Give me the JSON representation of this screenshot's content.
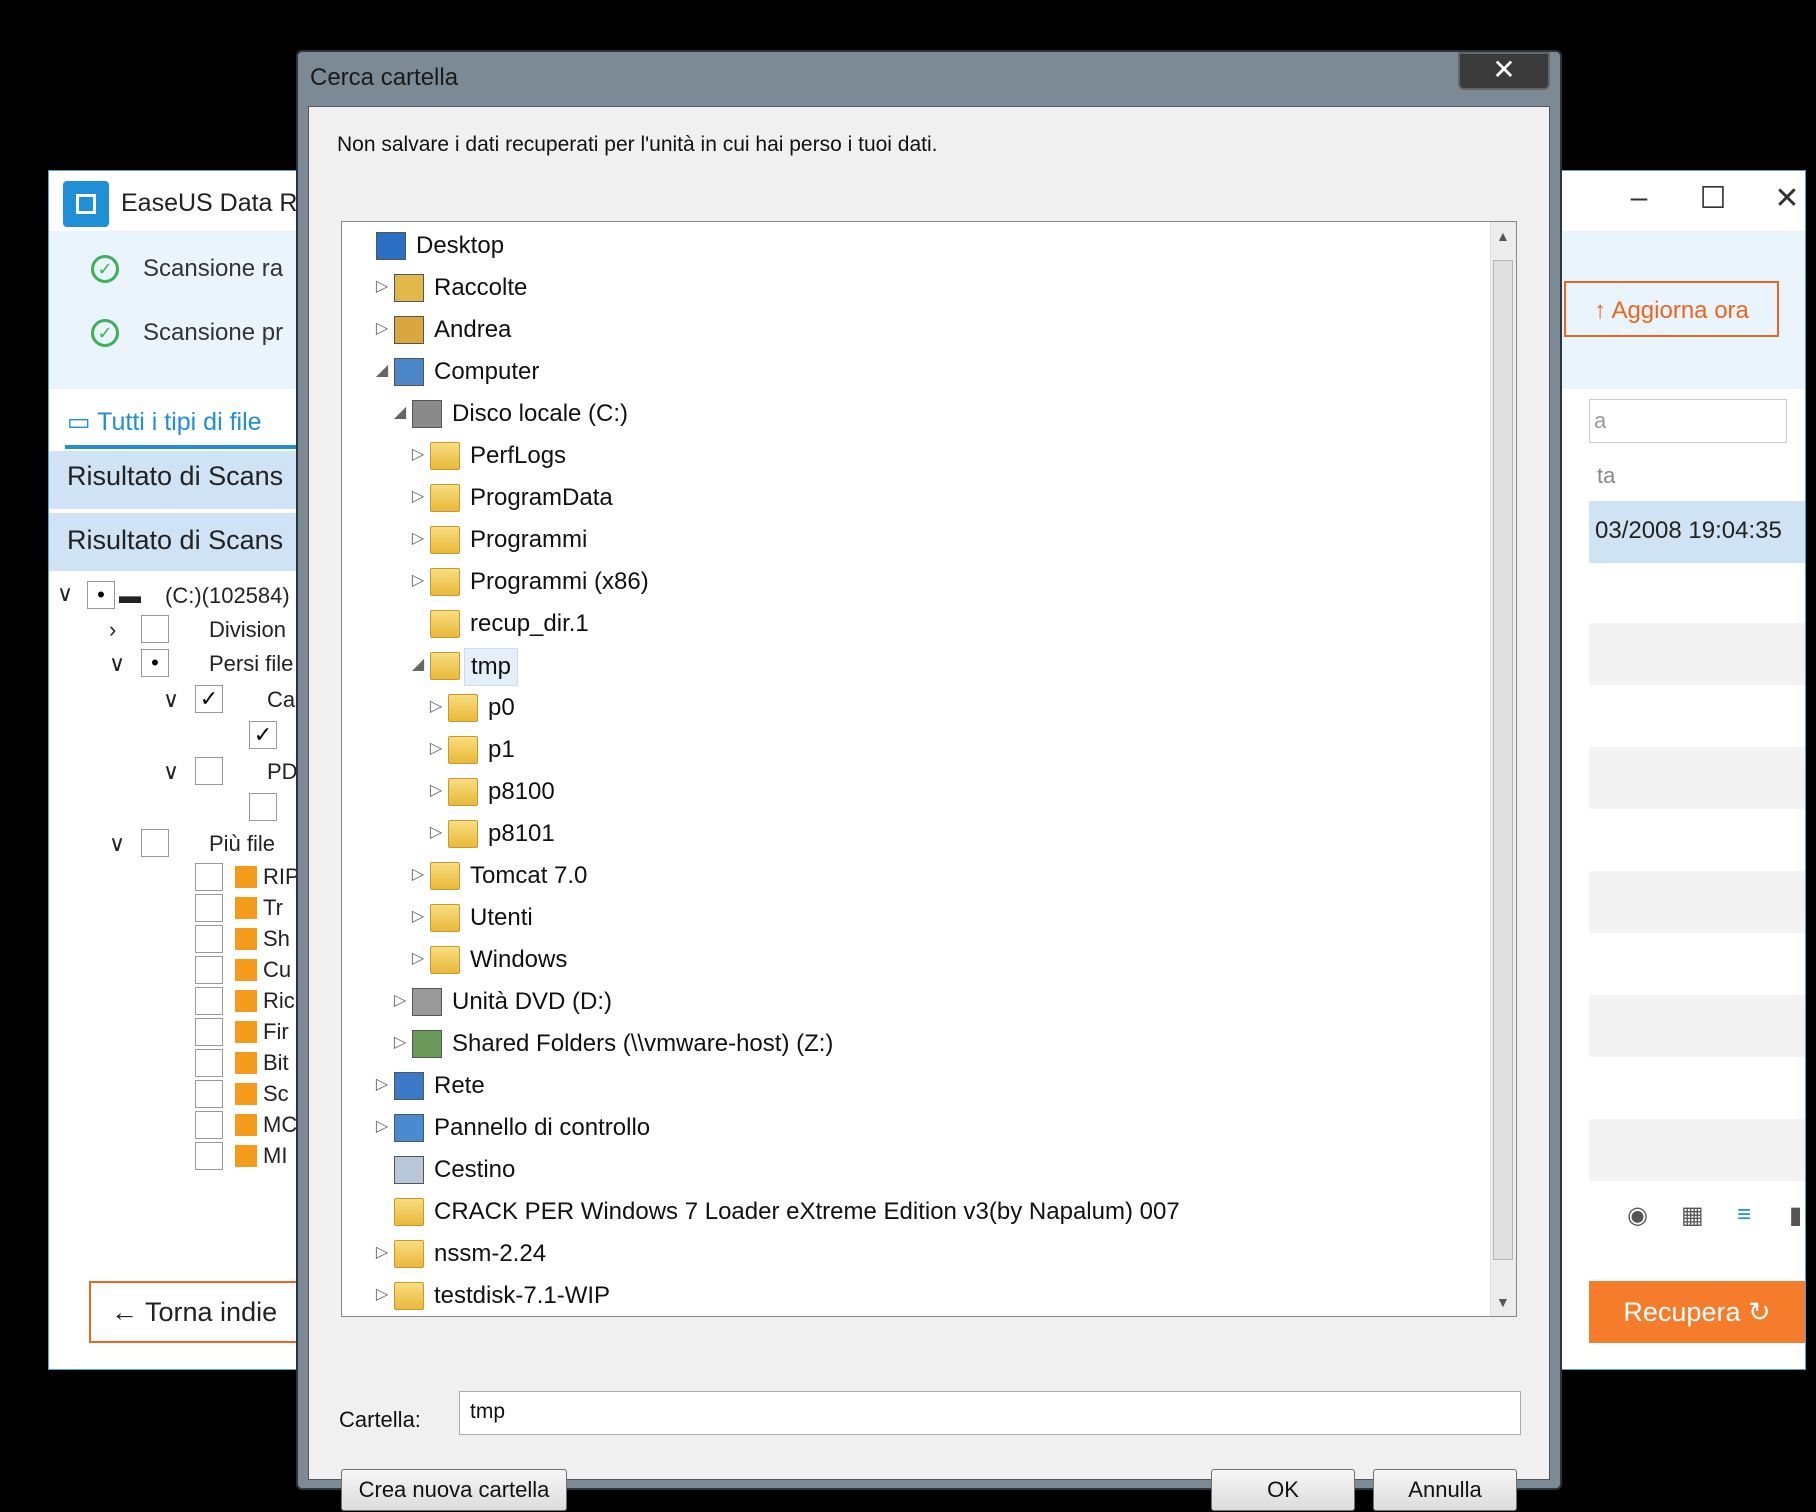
{
  "background_app": {
    "title": "EaseUS Data R",
    "scan_quick": "Scansione ra",
    "scan_deep": "Scansione pr",
    "update_button": "Aggiorna ora",
    "tab_all_types": "Tutti i tipi di file",
    "result_1": "Risultato di Scans",
    "result_2": "Risultato di Scans",
    "drive_node": "(C:)(102584)",
    "node_partition": "Division",
    "node_lost": "Persi file",
    "node_ca": "Ca",
    "node_pd": "PD",
    "node_more": "Più file",
    "sub_items": [
      "RIP",
      "Tr",
      "Sh",
      "Cu",
      "Ric",
      "Fir",
      "Bit",
      "Sc",
      "MC",
      "MI"
    ],
    "search_hint": "a",
    "col_header": "ta",
    "row_date": "03/2008 19:04:35",
    "back_button": "Torna indie",
    "recover_button": "Recupera"
  },
  "dialog": {
    "title": "Cerca cartella",
    "close_label": "✕",
    "warning": "Non salvare i dati recuperati per l'unità in cui hai perso i tuoi dati.",
    "tree": [
      {
        "label": "Desktop",
        "level": 0,
        "expander": "",
        "icon": "desktop-icon"
      },
      {
        "label": "Raccolte",
        "level": 1,
        "expander": "▷",
        "icon": "libraries-icon"
      },
      {
        "label": "Andrea",
        "level": 1,
        "expander": "▷",
        "icon": "user-folder-icon"
      },
      {
        "label": "Computer",
        "level": 1,
        "expander": "◢",
        "icon": "computer-icon"
      },
      {
        "label": "Disco locale (C:)",
        "level": 2,
        "expander": "◢",
        "icon": "local-disk-icon"
      },
      {
        "label": "PerfLogs",
        "level": 3,
        "expander": "▷",
        "icon": "folder-icon"
      },
      {
        "label": "ProgramData",
        "level": 3,
        "expander": "▷",
        "icon": "folder-icon"
      },
      {
        "label": "Programmi",
        "level": 3,
        "expander": "▷",
        "icon": "folder-icon"
      },
      {
        "label": "Programmi (x86)",
        "level": 3,
        "expander": "▷",
        "icon": "folder-icon"
      },
      {
        "label": "recup_dir.1",
        "level": 3,
        "expander": "",
        "icon": "folder-icon"
      },
      {
        "label": "tmp",
        "level": 3,
        "expander": "◢",
        "icon": "folder-icon",
        "selected": true
      },
      {
        "label": "p0",
        "level": 4,
        "expander": "▷",
        "icon": "folder-icon"
      },
      {
        "label": "p1",
        "level": 4,
        "expander": "▷",
        "icon": "folder-icon"
      },
      {
        "label": "p8100",
        "level": 4,
        "expander": "▷",
        "icon": "folder-icon"
      },
      {
        "label": "p8101",
        "level": 4,
        "expander": "▷",
        "icon": "folder-icon"
      },
      {
        "label": "Tomcat 7.0",
        "level": 3,
        "expander": "▷",
        "icon": "folder-icon"
      },
      {
        "label": "Utenti",
        "level": 3,
        "expander": "▷",
        "icon": "folder-icon"
      },
      {
        "label": "Windows",
        "level": 3,
        "expander": "▷",
        "icon": "folder-icon"
      },
      {
        "label": "Unità DVD (D:)",
        "level": 2,
        "expander": "▷",
        "icon": "dvd-drive-icon"
      },
      {
        "label": "Shared Folders (\\\\vmware-host) (Z:)",
        "level": 2,
        "expander": "▷",
        "icon": "network-drive-icon"
      },
      {
        "label": "Rete",
        "level": 1,
        "expander": "▷",
        "icon": "network-icon"
      },
      {
        "label": "Pannello di controllo",
        "level": 1,
        "expander": "▷",
        "icon": "control-panel-icon"
      },
      {
        "label": "Cestino",
        "level": 1,
        "expander": "",
        "icon": "recycle-bin-icon"
      },
      {
        "label": "CRACK PER Windows 7 Loader eXtreme Edition v3(by Napalum) 007",
        "level": 1,
        "expander": "",
        "icon": "folder-icon"
      },
      {
        "label": "nssm-2.24",
        "level": 1,
        "expander": "▷",
        "icon": "folder-icon"
      },
      {
        "label": "testdisk-7.1-WIP",
        "level": 1,
        "expander": "▷",
        "icon": "folder-icon"
      }
    ],
    "folder_label": "Cartella:",
    "folder_value": "tmp",
    "new_folder_button": "Crea nuova cartella",
    "ok_button": "OK",
    "cancel_button": "Annulla"
  }
}
